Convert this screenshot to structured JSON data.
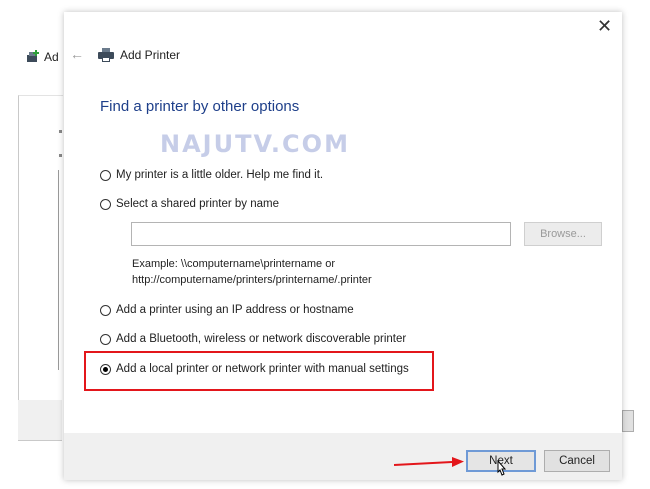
{
  "background_window": {
    "title": "Ad"
  },
  "dialog": {
    "title": "Add Printer",
    "heading": "Find a printer by other options",
    "watermark": "NAJUTV.COM",
    "options": [
      {
        "label": "My printer is a little older. Help me find it.",
        "checked": false
      },
      {
        "label": "Select a shared printer by name",
        "checked": false
      },
      {
        "label": "Add a printer using an IP address or hostname",
        "checked": false
      },
      {
        "label": "Add a Bluetooth, wireless or network discoverable printer",
        "checked": false
      },
      {
        "label": "Add a local printer or network printer with manual settings",
        "checked": true
      }
    ],
    "shared_printer_input": {
      "value": ""
    },
    "browse_label": "Browse...",
    "example_line1": "Example: \\\\computername\\printername or",
    "example_line2": "http://computername/printers/printername/.printer",
    "buttons": {
      "next": "Next",
      "cancel": "Cancel"
    }
  },
  "icons": {
    "close": "close-icon",
    "back": "back-arrow-icon",
    "printer": "printer-icon",
    "cursor": "mouse-cursor-icon"
  },
  "colors": {
    "heading": "#1e3f8a",
    "highlight": "#e3161b",
    "arrow": "#e3161b",
    "watermark": "#c6cde8",
    "next_border": "#6f9ad6"
  }
}
